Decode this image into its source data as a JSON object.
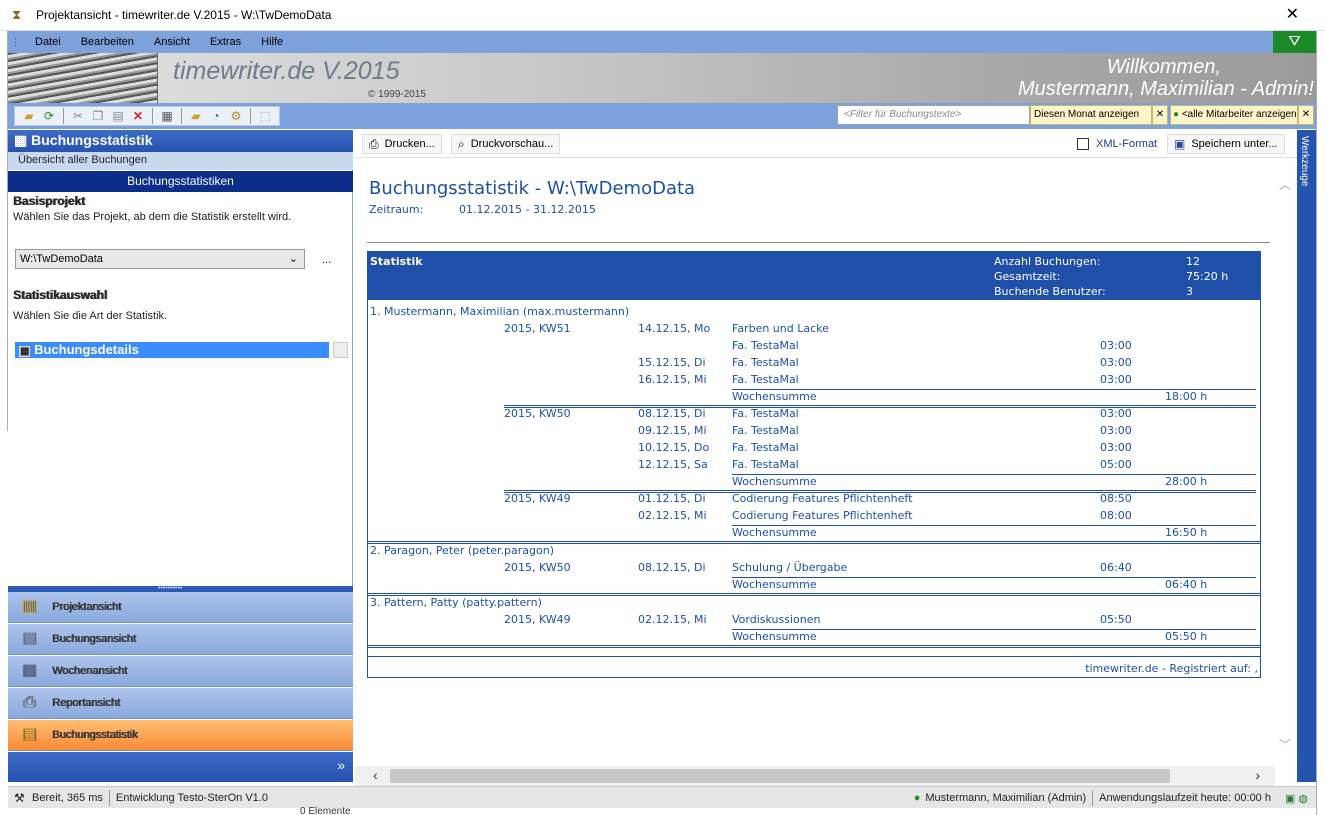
{
  "window": {
    "title": "Projektansicht - timewriter.de V.2015 - W:\\TwDemoData",
    "close": "✕"
  },
  "menu": [
    "Datei",
    "Bearbeiten",
    "Ansicht",
    "Extras",
    "Hilfe"
  ],
  "banner": {
    "brand": "timewriter.de V.2015",
    "copyright": "© 1999-2015",
    "welcome_line1": "Willkommen,",
    "welcome_line2": "Mustermann, Maximilian  - Admin!"
  },
  "toolbar": {
    "filter_placeholder": "<Filter für Buchungstexte>",
    "month_filter": "Diesen Monat anzeigen",
    "user_filter": "<alle Mitarbeiter anzeigen>",
    "clear": "✕"
  },
  "left_panel": {
    "header": "Buchungsstatistik",
    "subheader": "Übersicht aller Buchungen",
    "section": "Buchungsstatistiken",
    "project_label": "Basisprojekt",
    "project_desc": "Wählen Sie das Projekt, ab dem die Statistik erstellt wird.",
    "project_value": "W:\\TwDemoData",
    "project_more": "...",
    "stat_label": "Statistikauswahl",
    "stat_desc": "Wählen Sie die Art der Statistik.",
    "stat_value": "Buchungsdetails"
  },
  "nav": [
    {
      "label": "Projektansicht",
      "icon": "folders-icon"
    },
    {
      "label": "Buchungsansicht",
      "icon": "bookings-icon"
    },
    {
      "label": "Wochenansicht",
      "icon": "calendar-icon"
    },
    {
      "label": "Reportansicht",
      "icon": "printer-icon"
    },
    {
      "label": "Buchungsstatistik",
      "icon": "statistics-icon"
    }
  ],
  "content_toolbar": {
    "print": "Drucken...",
    "preview": "Druckvorschau...",
    "xml": "XML-Format",
    "save": "Speichern unter..."
  },
  "side_tab": "Werkzeuge",
  "report": {
    "title": "Buchungsstatistik - W:\\TwDemoData",
    "period_label": "Zeitraum:",
    "period_value": "01.12.2015 - 31.12.2015",
    "header_label": "Statistik",
    "summary": [
      {
        "label": "Anzahl Buchungen:",
        "value": "12"
      },
      {
        "label": "Gesamtzeit:",
        "value": "75:20 h"
      },
      {
        "label": "Buchende Benutzer:",
        "value": "3"
      }
    ],
    "users": [
      {
        "name": "1. Mustermann, Maximilian (max.mustermann)",
        "weeks": [
          {
            "week": "2015, KW51",
            "sum_label": "Wochensumme",
            "sum": "18:00 h",
            "days": [
              {
                "date": "14.12.15, Mo",
                "entries": [
                  {
                    "text": "Farben und Lacke",
                    "time": ""
                  },
                  {
                    "text": "Fa. TestaMal",
                    "time": "03:00"
                  }
                ]
              },
              {
                "date": "15.12.15, Di",
                "entries": [
                  {
                    "text": "Fa. TestaMal",
                    "time": "03:00"
                  }
                ]
              },
              {
                "date": "16.12.15, Mi",
                "entries": [
                  {
                    "text": "Fa. TestaMal",
                    "time": "03:00"
                  }
                ]
              }
            ]
          },
          {
            "week": "2015, KW50",
            "sum_label": "Wochensumme",
            "sum": "28:00 h",
            "days": [
              {
                "date": "08.12.15, Di",
                "entries": [
                  {
                    "text": "Fa. TestaMal",
                    "time": "03:00"
                  }
                ]
              },
              {
                "date": "09.12.15, Mi",
                "entries": [
                  {
                    "text": "Fa. TestaMal",
                    "time": "03:00"
                  }
                ]
              },
              {
                "date": "10.12.15, Do",
                "entries": [
                  {
                    "text": "Fa. TestaMal",
                    "time": "03:00"
                  }
                ]
              },
              {
                "date": "12.12.15, Sa",
                "entries": [
                  {
                    "text": "Fa. TestaMal",
                    "time": "05:00"
                  }
                ]
              }
            ]
          },
          {
            "week": "2015, KW49",
            "sum_label": "Wochensumme",
            "sum": "16:50 h",
            "days": [
              {
                "date": "01.12.15, Di",
                "entries": [
                  {
                    "text": "Codierung Features Pflichtenheft",
                    "time": "08:50"
                  }
                ]
              },
              {
                "date": "02.12.15, Mi",
                "entries": [
                  {
                    "text": "Codierung Features Pflichtenheft",
                    "time": "08:00"
                  }
                ]
              }
            ]
          }
        ]
      },
      {
        "name": "2. Paragon, Peter (peter.paragon)",
        "weeks": [
          {
            "week": "2015, KW50",
            "sum_label": "Wochensumme",
            "sum": "06:40 h",
            "days": [
              {
                "date": "08.12.15, Di",
                "entries": [
                  {
                    "text": "Schulung / Übergabe",
                    "time": "06:40"
                  }
                ]
              }
            ]
          }
        ]
      },
      {
        "name": "3. Pattern, Patty (patty.pattern)",
        "weeks": [
          {
            "week": "2015, KW49",
            "sum_label": "Wochensumme",
            "sum": "05:50 h",
            "days": [
              {
                "date": "02.12.15, Mi",
                "entries": [
                  {
                    "text": "Vordiskussionen",
                    "time": "05:50"
                  }
                ]
              }
            ]
          }
        ]
      }
    ],
    "footer": "timewriter.de - Registriert auf: ,"
  },
  "status": {
    "ready": "Bereit, 365 ms",
    "plugin": "Entwicklung Testo-SterOn V1.0",
    "user": "Mustermann, Maximilian  (Admin)",
    "runtime": "Anwendungslaufzeit heute: 00:00 h",
    "elements": "0 Elemente"
  }
}
